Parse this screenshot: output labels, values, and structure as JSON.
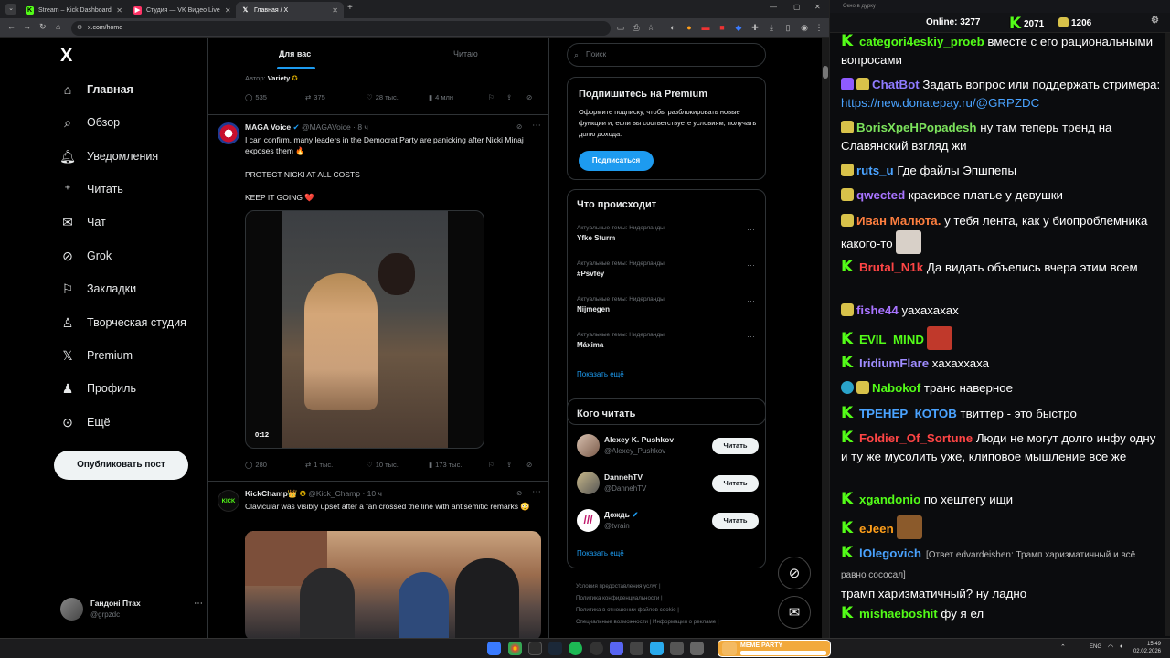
{
  "browser": {
    "tabs": [
      {
        "label": "Stream – Kick Dashboard",
        "active": false
      },
      {
        "label": "Студия — VK Видео Live",
        "active": false
      },
      {
        "label": "Главная / X",
        "active": true
      }
    ],
    "url": "x.com/home"
  },
  "xnav": {
    "logo": "X",
    "items": [
      {
        "label": "Главная",
        "icon": "home-icon"
      },
      {
        "label": "Обзор",
        "icon": "search-icon"
      },
      {
        "label": "Уведомления",
        "icon": "bell-icon"
      },
      {
        "label": "Читать",
        "icon": "add-user-icon"
      },
      {
        "label": "Чат",
        "icon": "mail-icon"
      },
      {
        "label": "Grok",
        "icon": "grok-icon"
      },
      {
        "label": "Закладки",
        "icon": "bookmark-icon"
      },
      {
        "label": "Творческая студия",
        "icon": "studio-icon"
      },
      {
        "label": "Premium",
        "icon": "x-icon"
      },
      {
        "label": "Профиль",
        "icon": "person-icon"
      },
      {
        "label": "Ещё",
        "icon": "more-icon"
      }
    ],
    "post_button": "Опубликовать пост",
    "account": {
      "name": "Гандоні Птах",
      "handle": "@grpzdc"
    }
  },
  "feed": {
    "tabs": [
      "Для вас",
      "Читаю"
    ],
    "prev_tweet": {
      "author_line_label": "Автор:",
      "author_line_name": "Variety",
      "replies": "535",
      "reposts": "375",
      "likes": "28 тыс.",
      "views": "4 млн"
    },
    "tweet1": {
      "name": "MAGA Voice",
      "handle": "@MAGAVoice",
      "time": "· 8 ч",
      "text1": "I can confirm, many leaders in the Democrat Party are panicking after Nicki Minaj exposes them 🔥",
      "text2": "PROTECT NICKI AT ALL COSTS",
      "text3": "KEEP IT GOING ❤️",
      "video_time": "0:12",
      "replies": "280",
      "reposts": "1 тыс.",
      "likes": "10 тыс.",
      "views": "173 тыс."
    },
    "tweet2": {
      "name": "KickChamp👑",
      "handle": "@Kick_Champ",
      "time": "· 10 ч",
      "avatar_text": "KICK",
      "text": "Clavicular was visibly upset after a fan crossed the line with antisemitic remarks 😳"
    }
  },
  "rcol": {
    "search_placeholder": "Поиск",
    "premium": {
      "title": "Подпишитесь на Premium",
      "text": "Оформите подписку, чтобы разблокировать новые функции и, если вы соответствуете условиям, получать долю дохода.",
      "button": "Подписаться"
    },
    "trends": {
      "title": "Что происходит",
      "items": [
        {
          "category": "Актуальные темы: Нидерланды",
          "name": "Yfke Sturm"
        },
        {
          "category": "Актуальные темы: Нидерланды",
          "name": "#Psvfey"
        },
        {
          "category": "Актуальные темы: Нидерланды",
          "name": "Nijmegen"
        },
        {
          "category": "Актуальные темы: Нидерланды",
          "name": "Máxima"
        }
      ],
      "show_more": "Показать ещё"
    },
    "who_to_follow": {
      "title": "Кого читать",
      "items": [
        {
          "name": "Alexey K. Pushkov",
          "handle": "@Alexey_Pushkov",
          "button": "Читать"
        },
        {
          "name": "DannehTV",
          "handle": "@DannehTV",
          "button": "Читать"
        },
        {
          "name": "Дождь",
          "handle": "@tvrain",
          "button": "Читать"
        }
      ],
      "show_more": "Показать ещё"
    },
    "footer": {
      "l1": "Условия предоставления услуг",
      "l2": "Политика конфиденциальности",
      "l3": "Политика в отношении файлов cookie",
      "l4a": "Специальные возможности",
      "l4b": "Информация о рекламе"
    }
  },
  "chat": {
    "window_title": "Окно в дурку",
    "online_label": "Online:",
    "online": "3277",
    "kick_count": "2071",
    "other_count": "1206",
    "messages": [
      {
        "user": "categori4eskiy_proeb",
        "color": "#53fc18",
        "text": "вместе с его рациональными вопросами"
      },
      {
        "user": "ChatBot",
        "color": "#8f7bff",
        "text": "Задать вопрос или поддержать стримера:",
        "link": "https://new.donatepay.ru/@GRPZDC"
      },
      {
        "user": "BorisXpeHPopadesh",
        "color": "#7ce35c",
        "text": "ну там теперь тренд на Славянский взгляд жи"
      },
      {
        "user": "ruts_u",
        "color": "#4aa3ff",
        "text": "Где файлы Эпшпепы"
      },
      {
        "user": "qwected",
        "color": "#a874ff",
        "text": "красивое платье у девушки"
      },
      {
        "user": "Иван Малюта.",
        "color": "#ff7f3f",
        "text": "у тебя лента, как у биопроблемника какого-то"
      },
      {
        "user": "Brutal_N1k",
        "color": "#ff4545",
        "text": "Да видать объелись вчера этим всем"
      },
      {
        "user": "fishe44",
        "color": "#a874ff",
        "text": "уахахахах"
      },
      {
        "user": "EVIL_MIND",
        "color": "#53fc18",
        "text": ""
      },
      {
        "user": "IridiumFlare",
        "color": "#9f8cff",
        "text": "хахаххаха"
      },
      {
        "user": "Nabokof",
        "color": "#53fc18",
        "text": "транс наверное"
      },
      {
        "user": "ТРЕНЕР_КОТОВ",
        "color": "#4aa3ff",
        "text": "твиттер - это быстро"
      },
      {
        "user": "Foldier_Of_Sortune",
        "color": "#ff4545",
        "text": "Люди не могут долго инфу одну и ту же мусолить уже, клиповое мышление все же"
      },
      {
        "user": "xgandonio",
        "color": "#53fc18",
        "text": "по хештегу ищи"
      },
      {
        "user": "eJeen",
        "color": "#ff9f1a",
        "text": ""
      },
      {
        "user": "lOlegovich",
        "color": "#4aa3ff",
        "reply": "[Ответ edvardeishen: Трамп харизматичный и всё равно сососал]",
        "text": "трамп харизматичный? ну ладно"
      },
      {
        "user": "mishaeboshit",
        "color": "#53fc18",
        "text": "фу я ел"
      }
    ]
  },
  "taskbar": {
    "lang": "ENG",
    "time": "15:49",
    "date": "02.02.2026",
    "meme_label": "MEME PARTY"
  },
  "colors": {
    "x_blue": "#1d9bf0",
    "kick_green": "#53fc18"
  }
}
